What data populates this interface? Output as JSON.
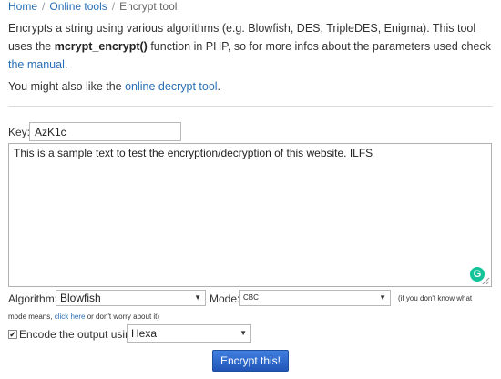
{
  "breadcrumb": {
    "items": [
      "Home",
      "Online tools",
      "Encrypt tool"
    ],
    "separator": "/"
  },
  "intro": {
    "text_before": "Encrypts a string using various algorithms (e.g. Blowfish, DES, TripleDES, Enigma). This tool uses the ",
    "function_name": "mcrypt_encrypt()",
    "text_middle": " function in PHP, so for more infos about the parameters used check ",
    "manual_link": "the manual",
    "text_end": "."
  },
  "also": {
    "text": "You might also like the ",
    "link": "online decrypt tool",
    "end": "."
  },
  "form": {
    "key_label": "Key:",
    "key_value": "AzK1c",
    "textarea_value": "This is a sample text to test the encryption/decryption of this website. ILFS",
    "algorithm_label": "Algorithm:",
    "algorithm_value": "Blowfish",
    "mode_label": "Mode:",
    "mode_value": "CBC",
    "mode_hint": "(if you don't know what",
    "mode_hint2_before": "mode means, ",
    "mode_hint2_link": "click here",
    "mode_hint2_after": " or don't worry about it)",
    "encode_checked": true,
    "encode_label": "Encode the output using",
    "encode_value": "Hexa",
    "submit_label": "Encrypt this!"
  },
  "icons": {
    "grammarly": "grammarly-icon",
    "dropdown": "chevron-down-icon",
    "resize": "resize-grip-icon"
  },
  "colors": {
    "link": "#2a6fb5",
    "button": "#2a64c8",
    "grammarly": "#15c39a"
  }
}
